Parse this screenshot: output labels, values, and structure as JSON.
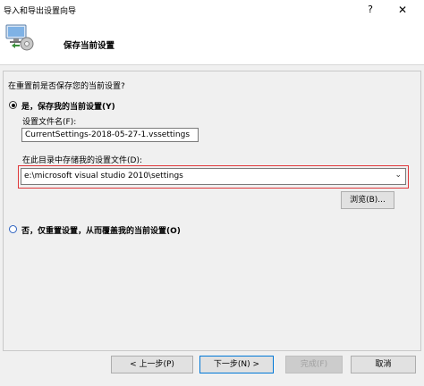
{
  "window": {
    "title": "导入和导出设置向导",
    "help_glyph": "?",
    "close_glyph": "✕"
  },
  "header": {
    "heading": "保存当前设置"
  },
  "main": {
    "question": "在重置前是否保存您的当前设置?",
    "option_save": {
      "label": "是，保存我的当前设置(Y)",
      "selected": true
    },
    "filename_label": "设置文件名(F):",
    "filename_value": "CurrentSettings-2018-05-27-1.vssettings",
    "directory_label": "在此目录中存储我的设置文件(D):",
    "directory_value": "e:\\microsoft visual studio 2010\\settings",
    "browse_label": "浏览(B)...",
    "option_overwrite": {
      "label": "否，仅重置设置，从而覆盖我的当前设置(O)",
      "selected": false
    }
  },
  "footer": {
    "prev_label": "< 上一步(P)",
    "next_label": "下一步(N) >",
    "finish_label": "完成(F)",
    "cancel_label": "取消"
  },
  "colors": {
    "highlight_border": "#e0383b",
    "primary_button_border": "#0078d7"
  }
}
